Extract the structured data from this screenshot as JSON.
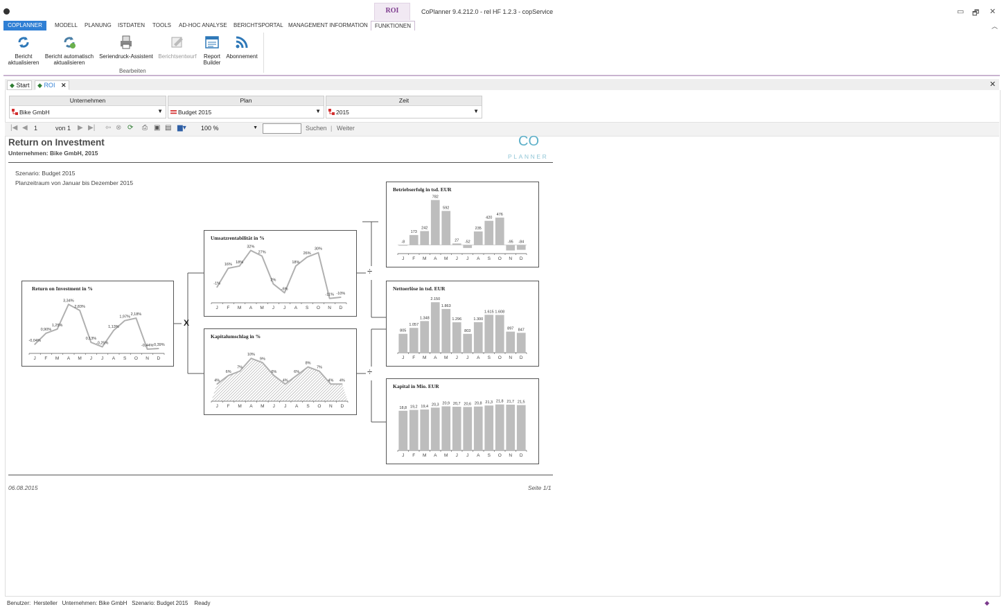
{
  "window": {
    "context_tab": "ROI",
    "title": "CoPlanner 9.4.212.0 - rel HF 1.2.3 - copService",
    "controls": [
      "▭",
      "🗗",
      "✕"
    ]
  },
  "ribbon_tabs": [
    "COPLANNER",
    "MODELL",
    "PLANUNG",
    "ISTDATEN",
    "TOOLS",
    "AD-HOC ANALYSE",
    "BERICHTSPORTAL",
    "MANAGEMENT INFORMATION",
    "FUNKTIONEN"
  ],
  "ribbon_buttons": [
    {
      "line1": "Bericht",
      "line2": "aktualisieren",
      "enabled": true
    },
    {
      "line1": "Bericht automatisch",
      "line2": "aktualisieren",
      "enabled": true
    },
    {
      "line1": "Seriendruck-Assistent",
      "line2": "",
      "enabled": true
    },
    {
      "line1": "Berichtsentwurf",
      "line2": "",
      "enabled": false
    },
    {
      "line1": "Report",
      "line2": "Builder",
      "enabled": true
    },
    {
      "line1": "Abonnement",
      "line2": "",
      "enabled": true
    }
  ],
  "ribbon_group_label": "Bearbeiten",
  "doc_tabs": [
    "Start",
    "ROI"
  ],
  "filters": [
    {
      "header": "Unternehmen",
      "value": "Bike GmbH"
    },
    {
      "header": "Plan",
      "value": "Budget 2015"
    },
    {
      "header": "Zeit",
      "value": "2015"
    }
  ],
  "toolbar": {
    "page": "1",
    "of_label": "von 1",
    "zoom": "100 %",
    "search_label": "Suchen",
    "next_label": "Weiter"
  },
  "report": {
    "title": "Return on Investment",
    "subtitle": "Unternehmen: Bike GmbH, 2015",
    "logo_top": "CO",
    "logo_bottom": "PLANNER",
    "scenario": "Szenario: Budget 2015",
    "period": "Planzeitraum von Januar bis Dezember 2015",
    "date": "06.08.2015",
    "page": "Seite 1/1",
    "operators": {
      "multiply": "X",
      "divide": "÷"
    }
  },
  "chart_data": [
    {
      "id": "roi",
      "type": "line",
      "title": "Return on Investment in %",
      "categories": [
        "J",
        "F",
        "M",
        "A",
        "M",
        "J",
        "J",
        "A",
        "S",
        "O",
        "N",
        "D"
      ],
      "values": [
        -0.04,
        0.9,
        1.25,
        3.34,
        2.83,
        0.13,
        -0.25,
        1.13,
        1.97,
        2.18,
        -0.44,
        -0.39
      ],
      "labels": [
        "-0,04%",
        "0,90%",
        "1,25%",
        "3,34%",
        "2,83%",
        "0,13%",
        "-0,25%",
        "1,13%",
        "1,97%",
        "2,18%",
        "-0,44%",
        "-0,39%"
      ],
      "ylim": [
        -0.8,
        4.0
      ]
    },
    {
      "id": "umsatz",
      "type": "line",
      "title": "Umsatzrentabilität in %",
      "categories": [
        "J",
        "F",
        "M",
        "A",
        "M",
        "J",
        "J",
        "A",
        "S",
        "O",
        "N",
        "D"
      ],
      "values": [
        -1,
        16,
        18,
        32,
        27,
        2,
        -6,
        18,
        26,
        30,
        -11,
        -10
      ],
      "labels": [
        "-1%",
        "16%",
        "18%",
        "32%",
        "27%",
        "2%",
        "-6%",
        "18%",
        "26%",
        "30%",
        "-11%",
        "-10%"
      ],
      "ylim": [
        -15,
        36
      ]
    },
    {
      "id": "kapitalumschlag",
      "type": "area",
      "title": "Kapitalumschlag in %",
      "categories": [
        "J",
        "F",
        "M",
        "A",
        "M",
        "J",
        "J",
        "A",
        "S",
        "O",
        "N",
        "D"
      ],
      "values": [
        4,
        6,
        7,
        10,
        9,
        6,
        4,
        6,
        8,
        7,
        4,
        4
      ],
      "labels": [
        "4%",
        "6%",
        "7%",
        "10%",
        "9%",
        "6%",
        "4%",
        "6%",
        "8%",
        "7%",
        "4%",
        "4%"
      ],
      "ylim": [
        0,
        11
      ]
    },
    {
      "id": "betriebserfolg",
      "type": "bar",
      "title": "Betriebserfolg in tsd. EUR",
      "categories": [
        "J",
        "F",
        "M",
        "A",
        "M",
        "J",
        "J",
        "A",
        "S",
        "O",
        "N",
        "D"
      ],
      "values": [
        -8,
        173,
        242,
        782,
        592,
        27,
        -52,
        235,
        420,
        476,
        -95,
        -84
      ],
      "labels": [
        "-8",
        "173",
        "242",
        "782",
        "592",
        "27",
        "-52",
        "235",
        "420",
        "476",
        "-95",
        "-84"
      ],
      "ylim": [
        -150,
        850
      ]
    },
    {
      "id": "nettoerloese",
      "type": "bar",
      "title": "Nettoerlöse in tsd. EUR",
      "categories": [
        "J",
        "F",
        "M",
        "A",
        "M",
        "J",
        "J",
        "A",
        "S",
        "O",
        "N",
        "D"
      ],
      "values": [
        805,
        1057,
        1348,
        2150,
        1863,
        1296,
        803,
        1300,
        1615,
        1608,
        897,
        847
      ],
      "labels": [
        "805",
        "1.057",
        "1.348",
        "2.150",
        "1.863",
        "1.296",
        "803",
        "1.300",
        "1.615",
        "1.608",
        "897",
        "847"
      ],
      "ylim": [
        0,
        2450
      ]
    },
    {
      "id": "kapital",
      "type": "bar",
      "title": "Kapital in Mio. EUR",
      "categories": [
        "J",
        "F",
        "M",
        "A",
        "M",
        "J",
        "J",
        "A",
        "S",
        "O",
        "N",
        "D"
      ],
      "values": [
        18.8,
        19.2,
        19.4,
        20.3,
        20.9,
        20.7,
        20.6,
        20.8,
        21.3,
        21.8,
        21.7,
        21.5
      ],
      "labels": [
        "18,8",
        "19,2",
        "19,4",
        "20,3",
        "20,9",
        "20,7",
        "20,6",
        "20,8",
        "21,3",
        "21,8",
        "21,7",
        "21,5"
      ],
      "ylim": [
        0,
        24
      ]
    }
  ],
  "status": {
    "text": "Benutzer:  Hersteller   Unternehmen: Bike GmbH   Szenario: Budget 2015    Ready"
  },
  "colors": {
    "accent": "#2f7fd4",
    "context": "#7c3a8d",
    "bar": "#bdbdbd",
    "line": "#b0b0b0",
    "logo": "#5db0c9"
  }
}
